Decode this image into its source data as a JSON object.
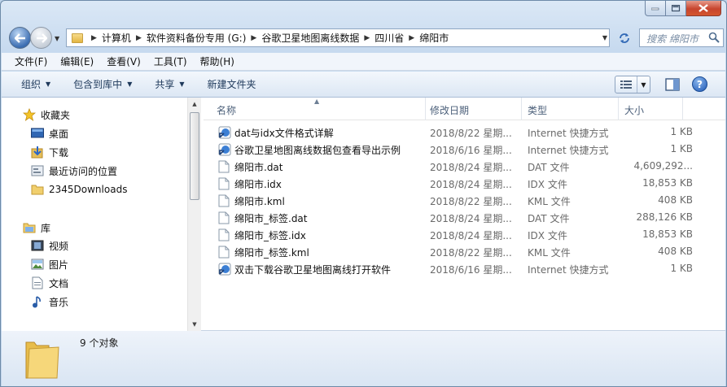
{
  "breadcrumb": [
    "计算机",
    "软件资料备份专用 (G:)",
    "谷歌卫星地图离线数据",
    "四川省",
    "绵阳市"
  ],
  "search": {
    "placeholder": "搜索 绵阳市"
  },
  "menu": [
    "文件(F)",
    "编辑(E)",
    "查看(V)",
    "工具(T)",
    "帮助(H)"
  ],
  "toolbar": {
    "organize": "组织",
    "include_library": "包含到库中",
    "share": "共享",
    "new_folder": "新建文件夹"
  },
  "nav": {
    "favorites": {
      "label": "收藏夹",
      "items": [
        "桌面",
        "下载",
        "最近访问的位置",
        "2345Downloads"
      ]
    },
    "libraries": {
      "label": "库",
      "items": [
        "视频",
        "图片",
        "文档",
        "音乐"
      ]
    }
  },
  "columns": {
    "name": "名称",
    "date": "修改日期",
    "type": "类型",
    "size": "大小"
  },
  "files": [
    {
      "name": "dat与idx文件格式详解",
      "date": "2018/8/22 星期...",
      "type": "Internet 快捷方式",
      "size": "1 KB",
      "icon": "internet-shortcut-icon"
    },
    {
      "name": "谷歌卫星地图离线数据包查看导出示例",
      "date": "2018/6/16 星期...",
      "type": "Internet 快捷方式",
      "size": "1 KB",
      "icon": "internet-shortcut-icon"
    },
    {
      "name": "绵阳市.dat",
      "date": "2018/8/24 星期...",
      "type": "DAT 文件",
      "size": "4,609,292...",
      "icon": "file-icon"
    },
    {
      "name": "绵阳市.idx",
      "date": "2018/8/24 星期...",
      "type": "IDX 文件",
      "size": "18,853 KB",
      "icon": "file-icon"
    },
    {
      "name": "绵阳市.kml",
      "date": "2018/8/22 星期...",
      "type": "KML 文件",
      "size": "408 KB",
      "icon": "file-icon"
    },
    {
      "name": "绵阳市_标签.dat",
      "date": "2018/8/24 星期...",
      "type": "DAT 文件",
      "size": "288,126 KB",
      "icon": "file-icon"
    },
    {
      "name": "绵阳市_标签.idx",
      "date": "2018/8/24 星期...",
      "type": "IDX 文件",
      "size": "18,853 KB",
      "icon": "file-icon"
    },
    {
      "name": "绵阳市_标签.kml",
      "date": "2018/8/22 星期...",
      "type": "KML 文件",
      "size": "408 KB",
      "icon": "file-icon"
    },
    {
      "name": "双击下载谷歌卫星地图离线打开软件",
      "date": "2018/6/16 星期...",
      "type": "Internet 快捷方式",
      "size": "1 KB",
      "icon": "internet-shortcut-icon"
    }
  ],
  "status": {
    "count": "9 个对象"
  }
}
